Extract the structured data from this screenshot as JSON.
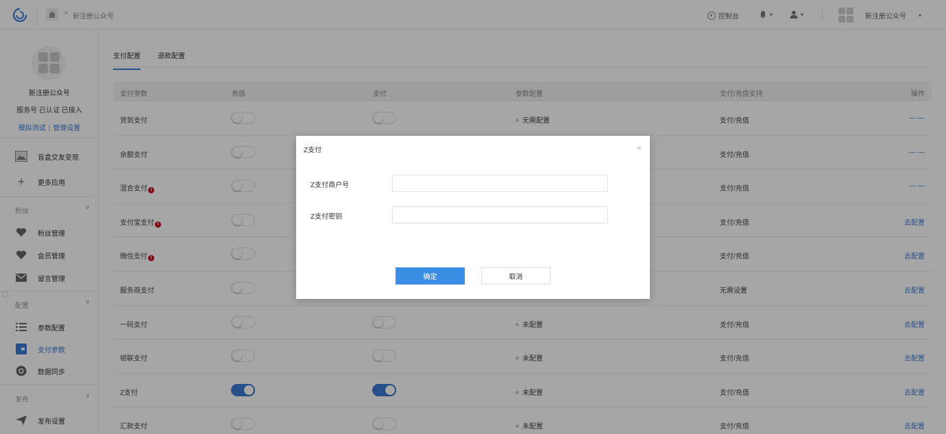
{
  "header": {
    "breadcrumb": "新注册公众号",
    "console_label": "控制台",
    "account_name": "新注册公众号"
  },
  "sidebar": {
    "account_name": "新注册公众号",
    "account_meta": "服务号 已认证 已接入",
    "link_test": "模拟测试",
    "link_separator": "|",
    "link_manage": "管理设置",
    "top_items": [
      {
        "label": "盲盒交友变现"
      },
      {
        "label": "更多应用"
      }
    ],
    "groups": [
      {
        "title": "粉丝",
        "items": [
          {
            "label": "粉丝管理"
          },
          {
            "label": "会员管理"
          },
          {
            "label": "留言管理"
          }
        ]
      },
      {
        "title": "配置",
        "items": [
          {
            "label": "参数配置"
          },
          {
            "label": "支付参数"
          },
          {
            "label": "数据同步"
          }
        ]
      },
      {
        "title": "发布",
        "items": [
          {
            "label": "发布设置"
          }
        ]
      }
    ]
  },
  "tabs": [
    {
      "label": "支付配置",
      "active": true
    },
    {
      "label": "退款配置",
      "active": false
    }
  ],
  "table": {
    "columns": [
      "支付参数",
      "充值",
      "支付",
      "参数配置",
      "支付/充值支持",
      "操作"
    ],
    "rows": [
      {
        "name": "货到支付",
        "warn": false,
        "recharge_on": false,
        "pay_on": false,
        "config": "无需配置",
        "support": "支付/充值",
        "action": "— —",
        "action_link": false
      },
      {
        "name": "余额支付",
        "warn": false,
        "recharge_on": false,
        "pay_on": false,
        "config": "",
        "support": "支付/充值",
        "action": "— —",
        "action_link": false
      },
      {
        "name": "混合支付",
        "warn": true,
        "recharge_on": false,
        "pay_on": false,
        "config": "",
        "support": "支付/充值",
        "action": "— —",
        "action_link": false
      },
      {
        "name": "支付宝支付",
        "warn": true,
        "recharge_on": false,
        "pay_on": false,
        "config": "",
        "support": "支付/充值",
        "action": "去配置",
        "action_link": true
      },
      {
        "name": "微信支付",
        "warn": true,
        "recharge_on": false,
        "pay_on": false,
        "config": "",
        "support": "支付/充值",
        "action": "去配置",
        "action_link": true
      },
      {
        "name": "服务商支付",
        "warn": false,
        "recharge_on": false,
        "pay_on": false,
        "config": "",
        "support": "无需设置",
        "action": "去配置",
        "action_link": true
      },
      {
        "name": "一码支付",
        "warn": false,
        "recharge_on": false,
        "pay_on": false,
        "config": "未配置",
        "support": "支付/充值",
        "action": "去配置",
        "action_link": true
      },
      {
        "name": "顿联支付",
        "warn": false,
        "recharge_on": false,
        "pay_on": false,
        "config": "未配置",
        "support": "支付/充值",
        "action": "去配置",
        "action_link": true
      },
      {
        "name": "Z支付",
        "warn": false,
        "recharge_on": true,
        "pay_on": true,
        "config": "未配置",
        "support": "支付/充值",
        "action": "去配置",
        "action_link": true
      },
      {
        "name": "汇款支付",
        "warn": false,
        "recharge_on": false,
        "pay_on": false,
        "config": "未配置",
        "support": "支付/充值",
        "action": "去配置",
        "action_link": true
      }
    ]
  },
  "modal": {
    "title": "Z支付",
    "fields": [
      {
        "label": "Z支付商户号",
        "value": "",
        "placeholder": ""
      },
      {
        "label": "Z支付密钥",
        "value": "",
        "placeholder": ""
      }
    ],
    "confirm_label": "确定",
    "cancel_label": "取消"
  },
  "colors": {
    "accent": "#3a7bd5",
    "primary_button": "#3a8ee6",
    "warning": "#d0021b"
  }
}
